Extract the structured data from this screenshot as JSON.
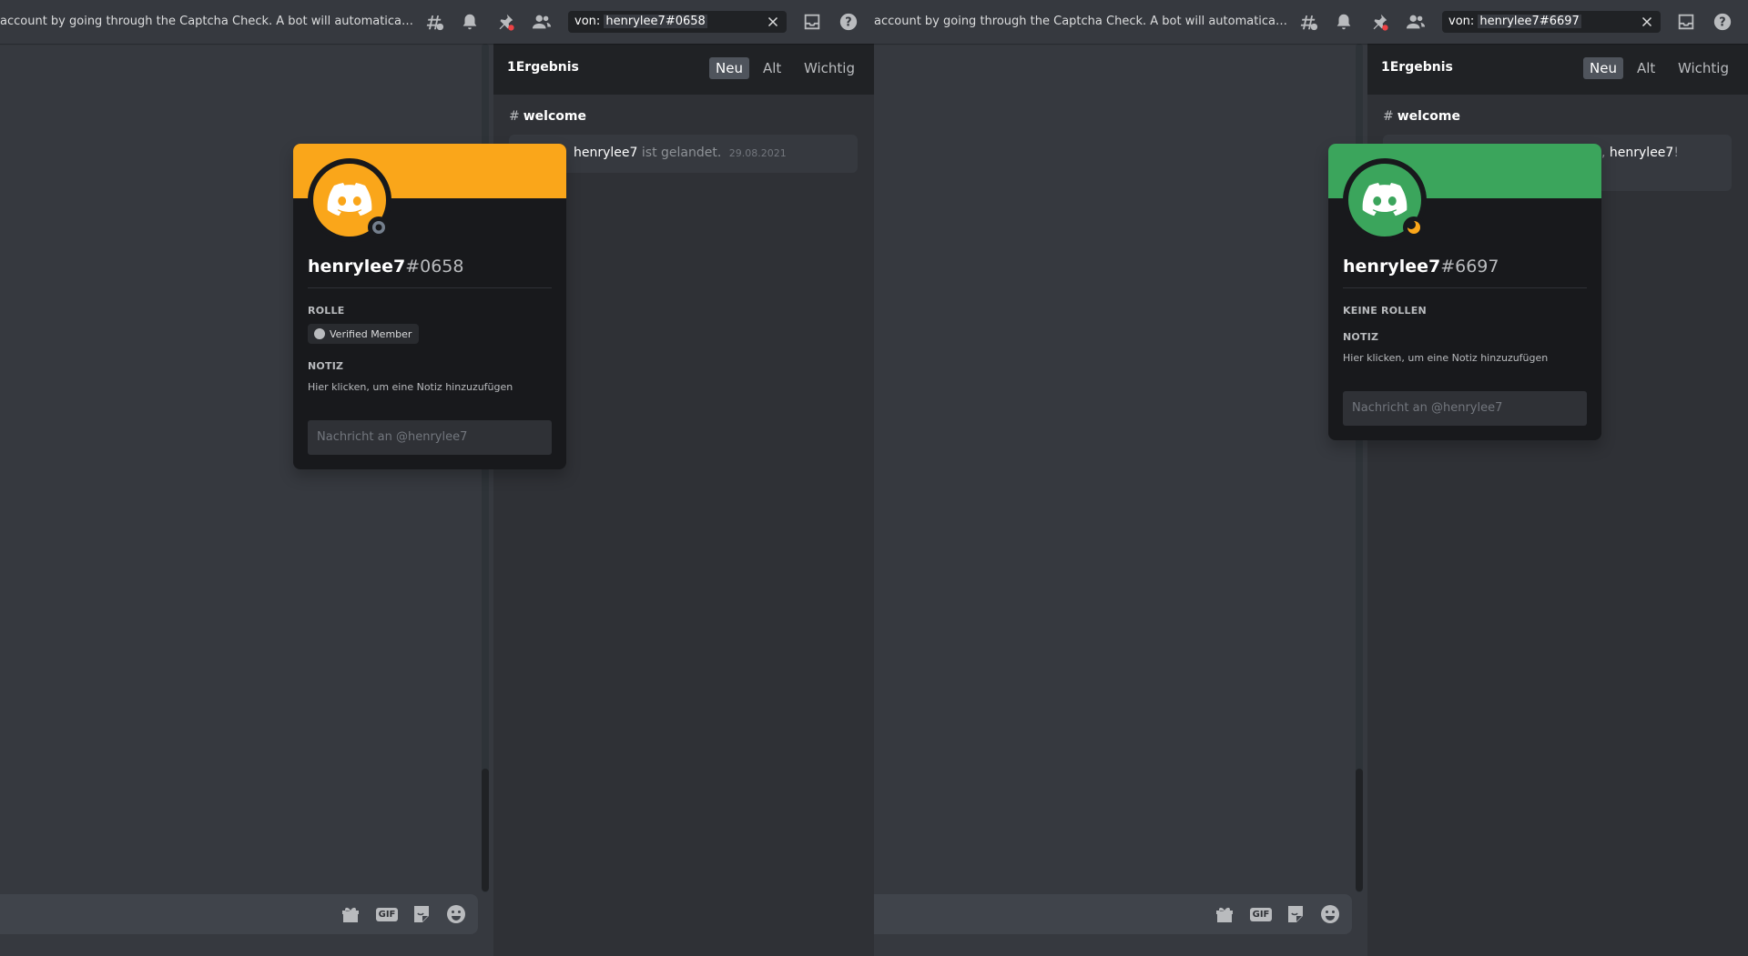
{
  "panes": [
    {
      "topic": "account by going through the Captcha Check. A bot will automatically send yo...",
      "search": {
        "prefix": "von:",
        "value": "henrylee7#0658"
      },
      "results": {
        "count_label": "1Ergebnis",
        "sort": [
          "Neu",
          "Alt",
          "Wichtig"
        ],
        "channel": "welcome",
        "message": {
          "user": "henrylee7",
          "text": "ist gelandet.",
          "time": "29.08.2021"
        }
      },
      "profile": {
        "name": "henrylee7",
        "discriminator": "#0658",
        "banner_color": "#faa61a",
        "roles_label": "ROLLE",
        "roles": [
          "Verified Member"
        ],
        "note_label": "NOTIZ",
        "note_placeholder": "Hier klicken, um eine Notiz hinzuzufügen",
        "message_placeholder": "Nachricht an @henrylee7",
        "status": "offline"
      }
    },
    {
      "topic": "account by going through the Captcha Check. A bot will automatically send yo...",
      "search": {
        "prefix": "von:",
        "value": "henrylee7#6697"
      },
      "results": {
        "count_label": "1Ergebnis",
        "sort": [
          "Neu",
          "Alt",
          "Wichtig"
        ],
        "channel": "welcome",
        "message": {
          "greeting_tail": ", ",
          "user": "henrylee7",
          "tail": "!"
        }
      },
      "profile": {
        "name": "henrylee7",
        "discriminator": "#6697",
        "banner_color": "#3ba55c",
        "roles_label": "KEINE ROLLEN",
        "roles": [],
        "note_label": "NOTIZ",
        "note_placeholder": "Hier klicken, um eine Notiz hinzuzufügen",
        "message_placeholder": "Nachricht an @henrylee7",
        "status": "idle"
      }
    }
  ],
  "colors": {
    "blurple": "#5865f2",
    "idle": "#faa61a",
    "offline": "#747f8d"
  }
}
